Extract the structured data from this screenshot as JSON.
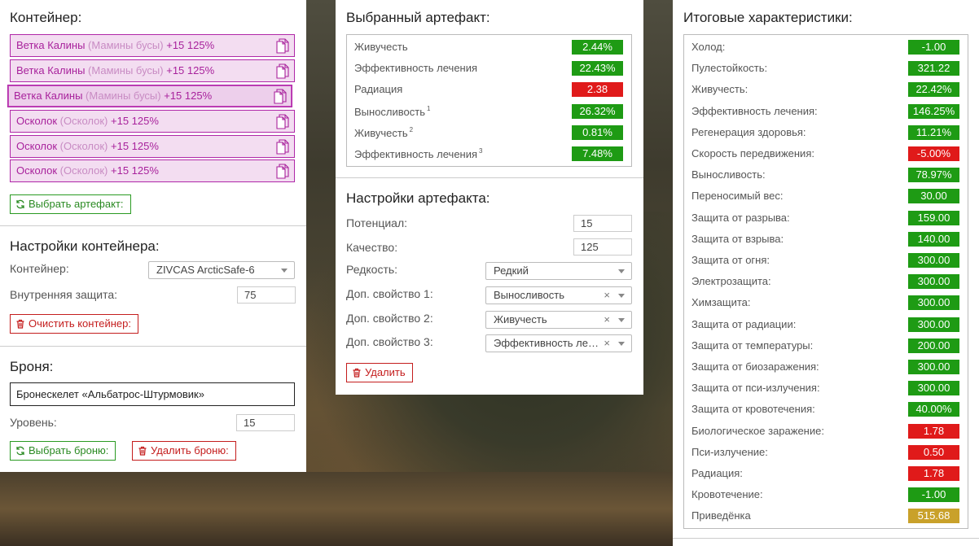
{
  "container": {
    "title": "Контейнер:",
    "items": [
      {
        "name": "Ветка Калины",
        "sub": "(Мамины бусы)",
        "bonus": "+15 125%"
      },
      {
        "name": "Ветка Калины",
        "sub": "(Мамины бусы)",
        "bonus": "+15 125%"
      },
      {
        "name": "Ветка Калины",
        "sub": "(Мамины бусы)",
        "bonus": "+15 125%"
      },
      {
        "name": "Осколок",
        "sub": "(Осколок)",
        "bonus": "+15 125%"
      },
      {
        "name": "Осколок",
        "sub": "(Осколок)",
        "bonus": "+15 125%"
      },
      {
        "name": "Осколок",
        "sub": "(Осколок)",
        "bonus": "+15 125%"
      }
    ],
    "select_button": "Выбрать артефакт:"
  },
  "container_settings": {
    "title": "Настройки контейнера:",
    "container_label": "Контейнер:",
    "container_value": "ZIVCAS ArcticSafe-6",
    "inner_protection_label": "Внутренняя защита:",
    "inner_protection_value": "75",
    "clear_button": "Очистить контейнер:"
  },
  "armor": {
    "title": "Броня:",
    "name": "Бронескелет «Альбатрос-Штурмовик»",
    "level_label": "Уровень:",
    "level_value": "15",
    "select_button": "Выбрать броню:",
    "delete_button": "Удалить броню:"
  },
  "selected_artifact": {
    "title": "Выбранный артефакт:",
    "stats": [
      {
        "name": "Живучесть",
        "sup": "",
        "value": "2.44%",
        "color": "#1e9b14"
      },
      {
        "name": "Эффективность лечения",
        "sup": "",
        "value": "22.43%",
        "color": "#1e9b14"
      },
      {
        "name": "Радиация",
        "sup": "",
        "value": "2.38",
        "color": "#e01a1a"
      },
      {
        "name": "Выносливость",
        "sup": "1",
        "value": "26.32%",
        "color": "#1e9b14"
      },
      {
        "name": "Живучесть",
        "sup": "2",
        "value": "0.81%",
        "color": "#1e9b14"
      },
      {
        "name": "Эффективность лечения",
        "sup": "3",
        "value": "7.48%",
        "color": "#1e9b14"
      }
    ]
  },
  "artifact_settings": {
    "title": "Настройки артефакта:",
    "potential_label": "Потенциал:",
    "potential_value": "15",
    "quality_label": "Качество:",
    "quality_value": "125",
    "rarity_label": "Редкость:",
    "rarity_value": "Редкий",
    "extra1_label": "Доп. свойство 1:",
    "extra1_value": "Выносливость",
    "extra2_label": "Доп. свойство 2:",
    "extra2_value": "Живучесть",
    "extra3_label": "Доп. свойство 3:",
    "extra3_value": "Эффективность ле…",
    "clear_symbol": "×",
    "delete_button": "Удалить"
  },
  "totals": {
    "title": "Итоговые характеристики:",
    "stats": [
      {
        "name": "Холод:",
        "value": "-1.00",
        "color": "#1e9b14"
      },
      {
        "name": "Пулестойкость:",
        "value": "321.22",
        "color": "#1e9b14"
      },
      {
        "name": "Живучесть:",
        "value": "22.42%",
        "color": "#1e9b14"
      },
      {
        "name": "Эффективность лечения:",
        "value": "146.25%",
        "color": "#1e9b14"
      },
      {
        "name": "Регенерация здоровья:",
        "value": "11.21%",
        "color": "#1e9b14"
      },
      {
        "name": "Скорость передвижения:",
        "value": "-5.00%",
        "color": "#e01a1a"
      },
      {
        "name": "Выносливость:",
        "value": "78.97%",
        "color": "#1e9b14"
      },
      {
        "name": "Переносимый вес:",
        "value": "30.00",
        "color": "#1e9b14"
      },
      {
        "name": "Защита от разрыва:",
        "value": "159.00",
        "color": "#1e9b14"
      },
      {
        "name": "Защита от взрыва:",
        "value": "140.00",
        "color": "#1e9b14"
      },
      {
        "name": "Защита от огня:",
        "value": "300.00",
        "color": "#1e9b14"
      },
      {
        "name": "Электрозащита:",
        "value": "300.00",
        "color": "#1e9b14"
      },
      {
        "name": "Химзащита:",
        "value": "300.00",
        "color": "#1e9b14"
      },
      {
        "name": "Защита от радиации:",
        "value": "300.00",
        "color": "#1e9b14"
      },
      {
        "name": "Защита от температуры:",
        "value": "200.00",
        "color": "#1e9b14"
      },
      {
        "name": "Защита от биозаражения:",
        "value": "300.00",
        "color": "#1e9b14"
      },
      {
        "name": "Защита от пси-излучения:",
        "value": "300.00",
        "color": "#1e9b14"
      },
      {
        "name": "Защита от кровотечения:",
        "value": "40.00%",
        "color": "#1e9b14"
      },
      {
        "name": "Биологическое заражение:",
        "value": "1.78",
        "color": "#e01a1a"
      },
      {
        "name": "Пси-излучение:",
        "value": "0.50",
        "color": "#e01a1a"
      },
      {
        "name": "Радиация:",
        "value": "1.78",
        "color": "#e01a1a"
      },
      {
        "name": "Кровотечение:",
        "value": "-1.00",
        "color": "#1e9b14"
      },
      {
        "name": "Приведёнка",
        "value": "515.68",
        "color": "#c9a12a"
      }
    ]
  }
}
